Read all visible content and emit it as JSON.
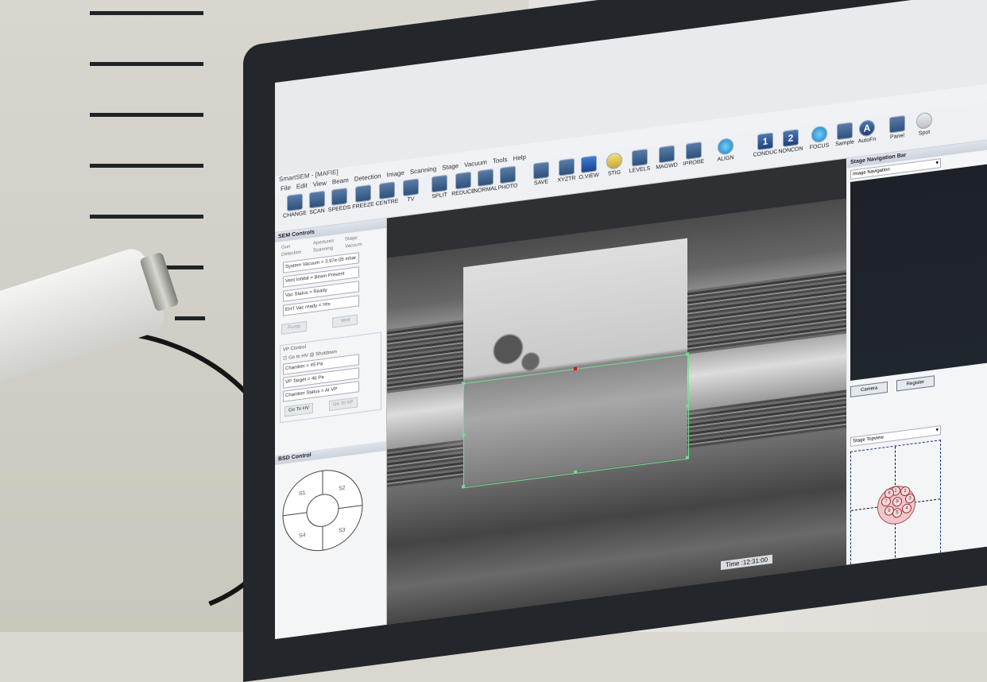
{
  "window": {
    "title": "SmartSEM - [MAFIE]",
    "menu": [
      "File",
      "Edit",
      "View",
      "Beam",
      "Detection",
      "Image",
      "Scanning",
      "Stage",
      "Vacuum",
      "Tools",
      "Help"
    ]
  },
  "toolbar": [
    {
      "label": "CHANGE",
      "icon": "change-icon"
    },
    {
      "label": "SCAN",
      "icon": "scan-icon"
    },
    {
      "label": "SPEEDS",
      "icon": "speeds-icon"
    },
    {
      "label": "FREEZE",
      "icon": "freeze-icon"
    },
    {
      "label": "CENTRE",
      "icon": "centre-icon"
    },
    {
      "label": "TV",
      "icon": "tv-icon"
    },
    {
      "label": "SPLIT",
      "icon": "split-icon"
    },
    {
      "label": "REDUCE",
      "icon": "reduce-icon"
    },
    {
      "label": "NORMAL",
      "icon": "normal-icon"
    },
    {
      "label": "PHOTO",
      "icon": "photo-icon"
    },
    {
      "label": "SAVE",
      "icon": "save-icon"
    },
    {
      "label": "XYZTR",
      "icon": "xyztr-icon"
    },
    {
      "label": "O.VIEW",
      "icon": "oview-icon"
    },
    {
      "label": "STIG",
      "icon": "stig-icon"
    },
    {
      "label": "LEVELS",
      "icon": "levels-icon"
    },
    {
      "label": "MAGWD",
      "icon": "magwd-icon"
    },
    {
      "label": "IPROBE",
      "icon": "iprobe-icon"
    },
    {
      "label": "ALIGN",
      "icon": "align-icon"
    },
    {
      "label": "CONDUC",
      "icon": "conduc-icon",
      "num": "1"
    },
    {
      "label": "NONCON",
      "icon": "noncon-icon",
      "num": "2"
    },
    {
      "label": "FOCUS",
      "icon": "focus-icon"
    },
    {
      "label": "Sample",
      "icon": "sample-icon"
    },
    {
      "label": "AutoFn",
      "icon": "autofn-icon",
      "num": "A"
    },
    {
      "label": "Panel",
      "icon": "panel-icon"
    },
    {
      "label": "Spot",
      "icon": "spot-icon"
    }
  ],
  "sem_controls": {
    "title": "SEM Controls",
    "tabs": [
      "Gun",
      "Apertures",
      "Stage",
      "Detection",
      "Scanning",
      "Vacuum"
    ],
    "status": [
      "System Vacuum = 3.97e-05 mbar",
      "Vent Inhibit = Beam Present",
      "Vac Status = Ready",
      "EHT Vac ready = Yes"
    ],
    "buttons": [
      "Pump",
      "Vent"
    ],
    "vp_control": {
      "title": "VP Control",
      "checkbox": "Go to HV @ Shutdown",
      "chamber": "Chamber =   45 Pa",
      "vp_target": "VP Target =   46 Pa",
      "chamber_status": "Chamber Status = At VP",
      "buttons": [
        "Go To HV",
        "Go To VP"
      ]
    }
  },
  "bsd_control": {
    "title": "BSD Control",
    "segments": [
      "S1",
      "S2",
      "S3",
      "S4"
    ]
  },
  "stage_nav": {
    "title": "Stage Navigation Bar",
    "dropdown": "Image Navigation",
    "camera": "Camera",
    "register": "Register",
    "topview": "Stage Topview",
    "slots": [
      "1",
      "2",
      "3",
      "4",
      "5",
      "6",
      "7",
      "8",
      "9"
    ]
  },
  "status": {
    "time": "Time :12:31:00"
  }
}
